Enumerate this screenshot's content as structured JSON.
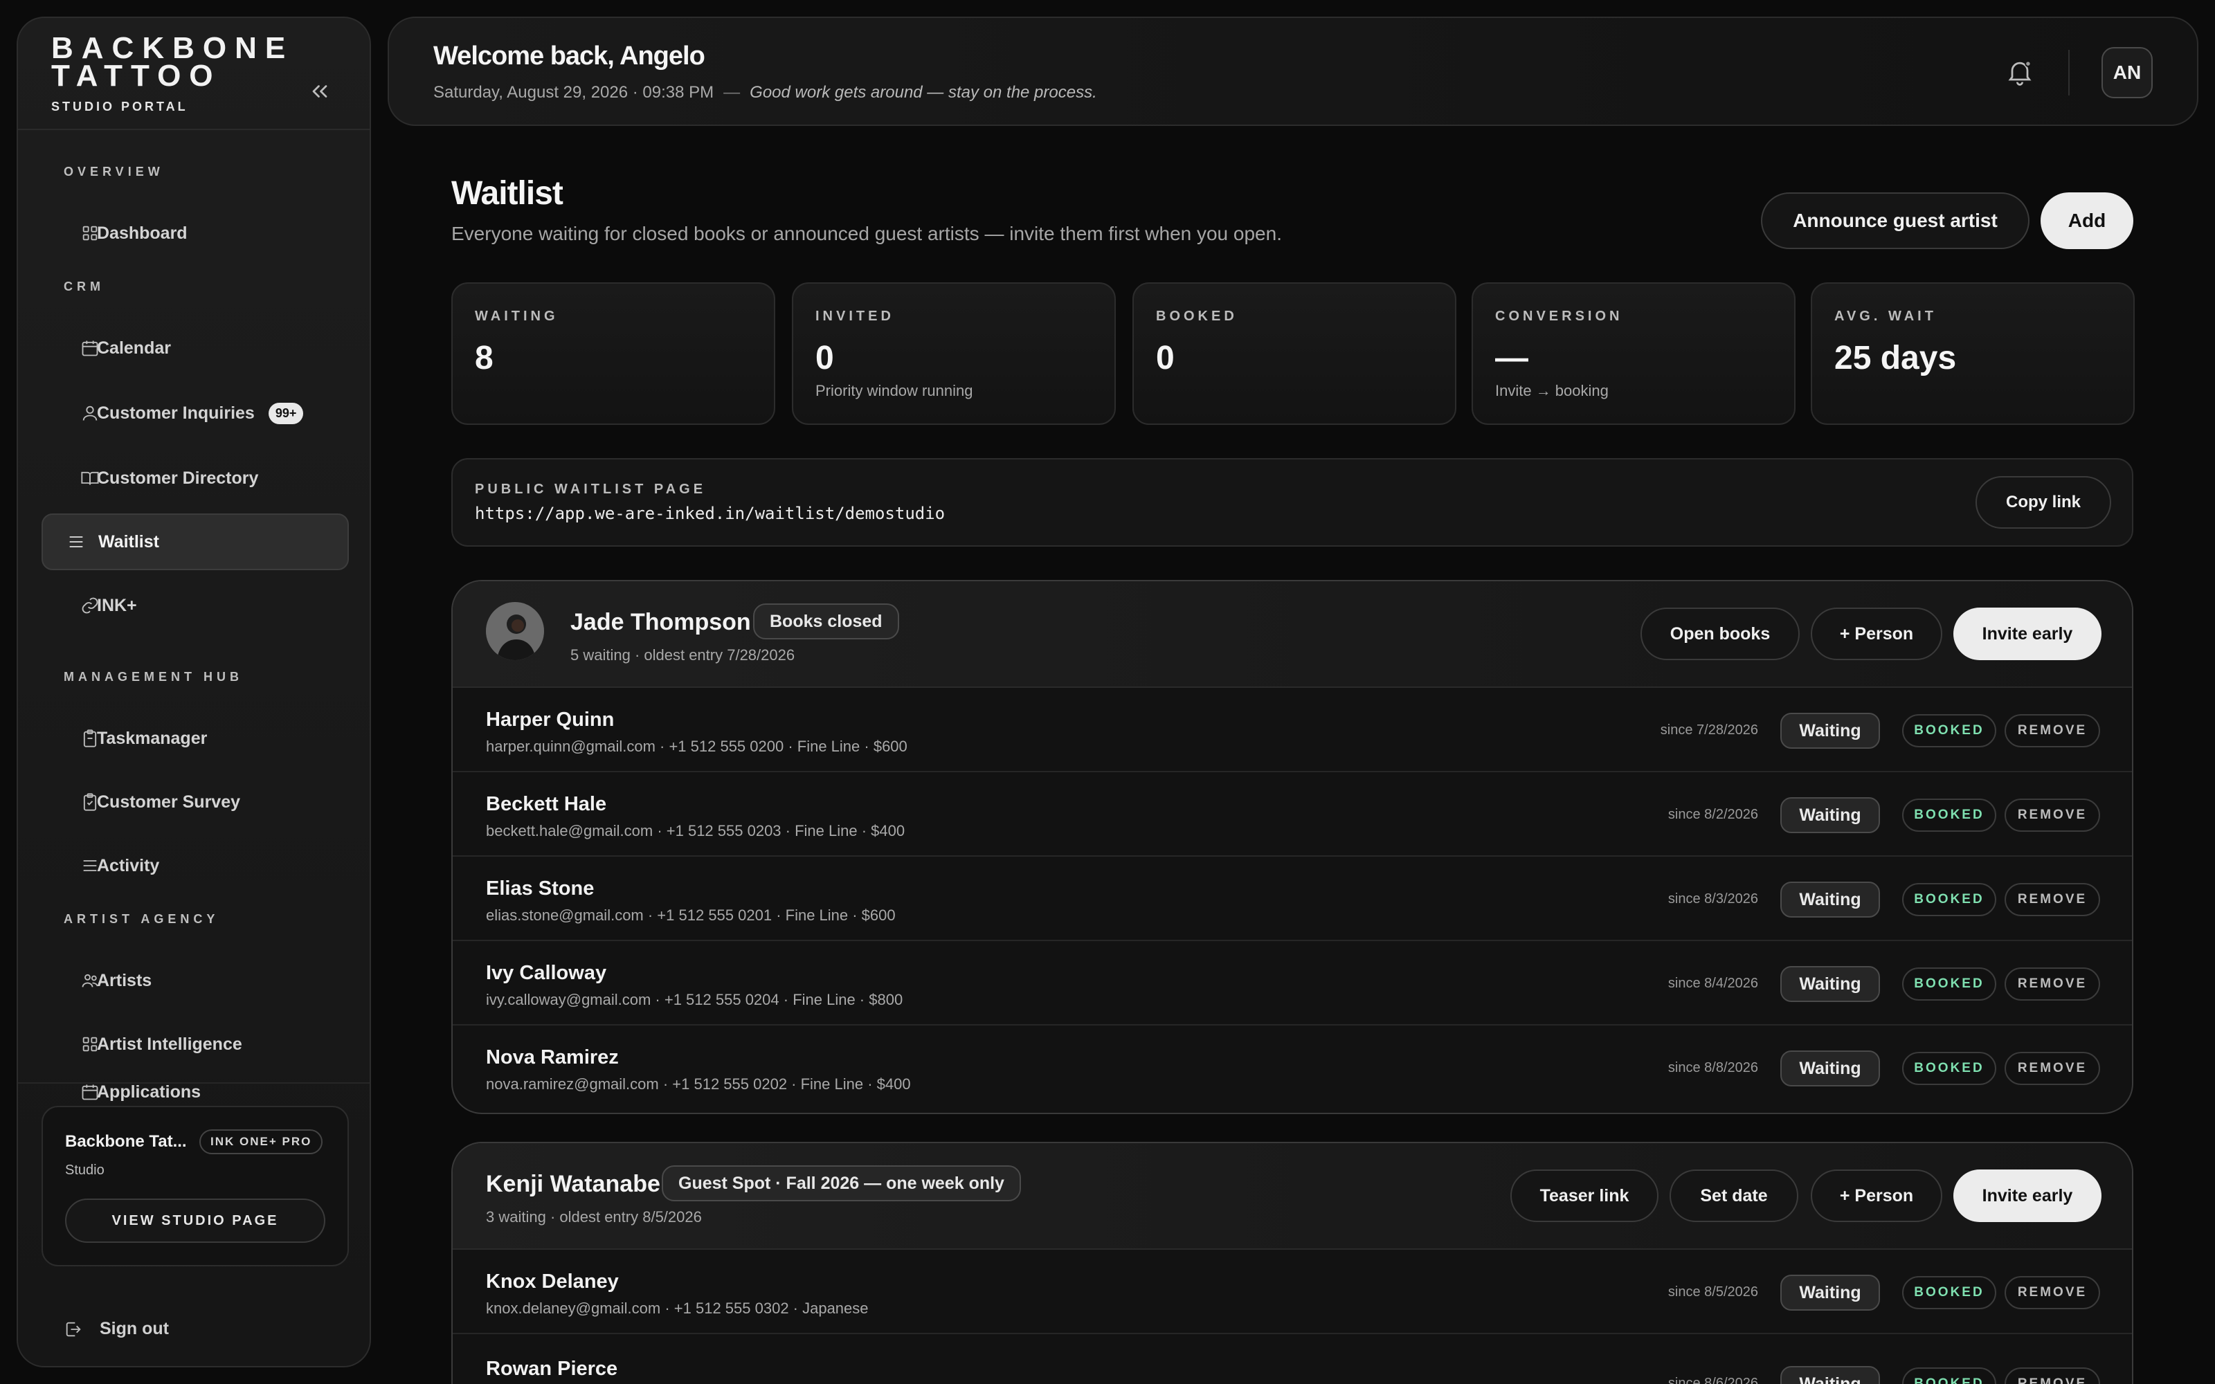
{
  "sidebar": {
    "brand_line1": "BACKBONE",
    "brand_line2": "TATTOO",
    "brand_sub": "STUDIO PORTAL",
    "collapse_icon": "chevrons-left-icon",
    "sections": {
      "overview": "OVERVIEW",
      "crm": "CRM",
      "management": "MANAGEMENT HUB",
      "agency": "ARTIST AGENCY"
    },
    "items": {
      "dashboard": "Dashboard",
      "calendar": "Calendar",
      "inquiries": "Customer Inquiries",
      "inquiries_badge": "99+",
      "directory": "Customer Directory",
      "waitlist": "Waitlist",
      "ink": "INK+",
      "taskmanager": "Taskmanager",
      "survey": "Customer Survey",
      "activity": "Activity",
      "artists": "Artists",
      "intelligence": "Artist Intelligence",
      "applications": "Applications"
    },
    "studio": {
      "name": "Backbone Tat...",
      "plan": "INK ONE+ PRO",
      "kind": "Studio",
      "button": "VIEW STUDIO PAGE"
    },
    "signout": "Sign out"
  },
  "header": {
    "welcome": "Welcome back, Angelo",
    "datetime": "Saturday, August 29, 2026 · 09:38 PM",
    "separator": "—",
    "motto": "Good work gets around — stay on the process.",
    "avatar_initials": "AN"
  },
  "page": {
    "title": "Waitlist",
    "subtitle": "Everyone waiting for closed books or announced guest artists — invite them first when you open.",
    "announce_label": "Announce guest artist",
    "add_label": "Add"
  },
  "stats": [
    {
      "label": "WAITING",
      "value": "8",
      "hint": ""
    },
    {
      "label": "INVITED",
      "value": "0",
      "hint": "Priority window running"
    },
    {
      "label": "BOOKED",
      "value": "0",
      "hint": ""
    },
    {
      "label": "CONVERSION",
      "value": "—",
      "hint": "Invite → booking"
    },
    {
      "label": "AVG. WAIT",
      "value": "25 days",
      "hint": ""
    }
  ],
  "public_page": {
    "label": "PUBLIC WAITLIST PAGE",
    "url": "https://app.we-are-inked.in/waitlist/demostudio",
    "copy_label": "Copy link"
  },
  "row_labels": {
    "status": "Waiting",
    "booked": "BOOKED",
    "remove": "REMOVE"
  },
  "groups": [
    {
      "artist": "Jade Thompson",
      "chip": "Books closed",
      "meta": "5 waiting · oldest entry 7/28/2026",
      "actions": [
        "Open books",
        "+ Person",
        "Invite early"
      ],
      "entries": [
        {
          "name": "Harper Quinn",
          "details": "harper.quinn@gmail.com · +1 512 555 0200 · Fine Line · $600",
          "since": "since 7/28/2026"
        },
        {
          "name": "Beckett Hale",
          "details": "beckett.hale@gmail.com · +1 512 555 0203 · Fine Line · $400",
          "since": "since 8/2/2026"
        },
        {
          "name": "Elias Stone",
          "details": "elias.stone@gmail.com · +1 512 555 0201 · Fine Line · $600",
          "since": "since 8/3/2026"
        },
        {
          "name": "Ivy Calloway",
          "details": "ivy.calloway@gmail.com · +1 512 555 0204 · Fine Line · $800",
          "since": "since 8/4/2026"
        },
        {
          "name": "Nova Ramirez",
          "details": "nova.ramirez@gmail.com · +1 512 555 0202 · Fine Line · $400",
          "since": "since 8/8/2026"
        }
      ]
    },
    {
      "artist": "Kenji Watanabe",
      "chip": "Guest Spot · Fall 2026 — one week only",
      "meta": "3 waiting · oldest entry 8/5/2026",
      "actions": [
        "Teaser link",
        "Set date",
        "+ Person",
        "Invite early"
      ],
      "entries": [
        {
          "name": "Knox Delaney",
          "details": "knox.delaney@gmail.com · +1 512 555 0302 · Japanese",
          "since": "since 8/5/2026"
        },
        {
          "name": "Rowan Pierce",
          "details": "",
          "since": "since 8/6/2026"
        }
      ]
    }
  ]
}
